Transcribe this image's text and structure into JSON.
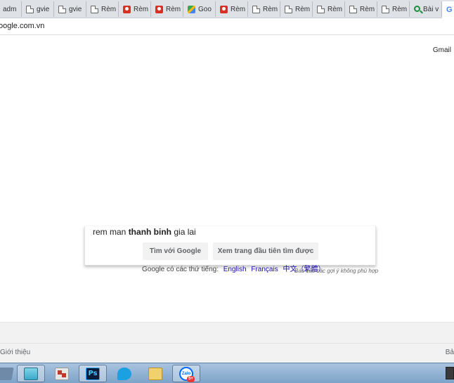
{
  "browser": {
    "tabs": [
      {
        "label": "adm",
        "favicon": "doc-icon"
      },
      {
        "label": "gvie",
        "favicon": "doc-icon"
      },
      {
        "label": "gvie",
        "favicon": "doc-icon"
      },
      {
        "label": "Rèm",
        "favicon": "doc-icon"
      },
      {
        "label": "Rèm",
        "favicon": "map-pin-icon"
      },
      {
        "label": "Rèm",
        "favicon": "map-pin-icon"
      },
      {
        "label": "Goo",
        "favicon": "google-maps-icon"
      },
      {
        "label": "Rèm",
        "favicon": "map-pin-icon"
      },
      {
        "label": "Rèm",
        "favicon": "doc-icon"
      },
      {
        "label": "Rèm",
        "favicon": "doc-icon"
      },
      {
        "label": "Rèm",
        "favicon": "doc-icon"
      },
      {
        "label": "Rèm",
        "favicon": "doc-icon"
      },
      {
        "label": "Rèm",
        "favicon": "doc-icon"
      },
      {
        "label": "Rèm",
        "favicon": "doc-icon"
      },
      {
        "label": "Bài v",
        "favicon": "search-icon"
      },
      {
        "label": "",
        "favicon": "google-icon",
        "active": true
      }
    ],
    "url": "oogle.com.vn"
  },
  "page": {
    "gmail": "Gmail",
    "suggestion": {
      "prefix": "rem man ",
      "bold": "thanh binh",
      "suffix": " gia lai"
    },
    "buttons": {
      "search": "Tìm với Google",
      "lucky": "Xem trang đầu tiên tìm được"
    },
    "languages": {
      "prefix": "Google có các thứ tiếng:",
      "items": [
        "English",
        "Français",
        "中文（繁體）"
      ]
    },
    "report": "Báo cáo các gợi ý không phù hợp",
    "footer": {
      "about": "Giới thiệu",
      "right": "Bả"
    }
  },
  "taskbar": {
    "items": [
      "tool-icon",
      "notepad-icon",
      "dictionary-icon",
      "photoshop-icon",
      "bird-app-icon",
      "folder-icon",
      "zalo-icon"
    ],
    "photoshop_label": "Ps",
    "zalo_label": "Zalo",
    "zalo_badge": "5+"
  }
}
